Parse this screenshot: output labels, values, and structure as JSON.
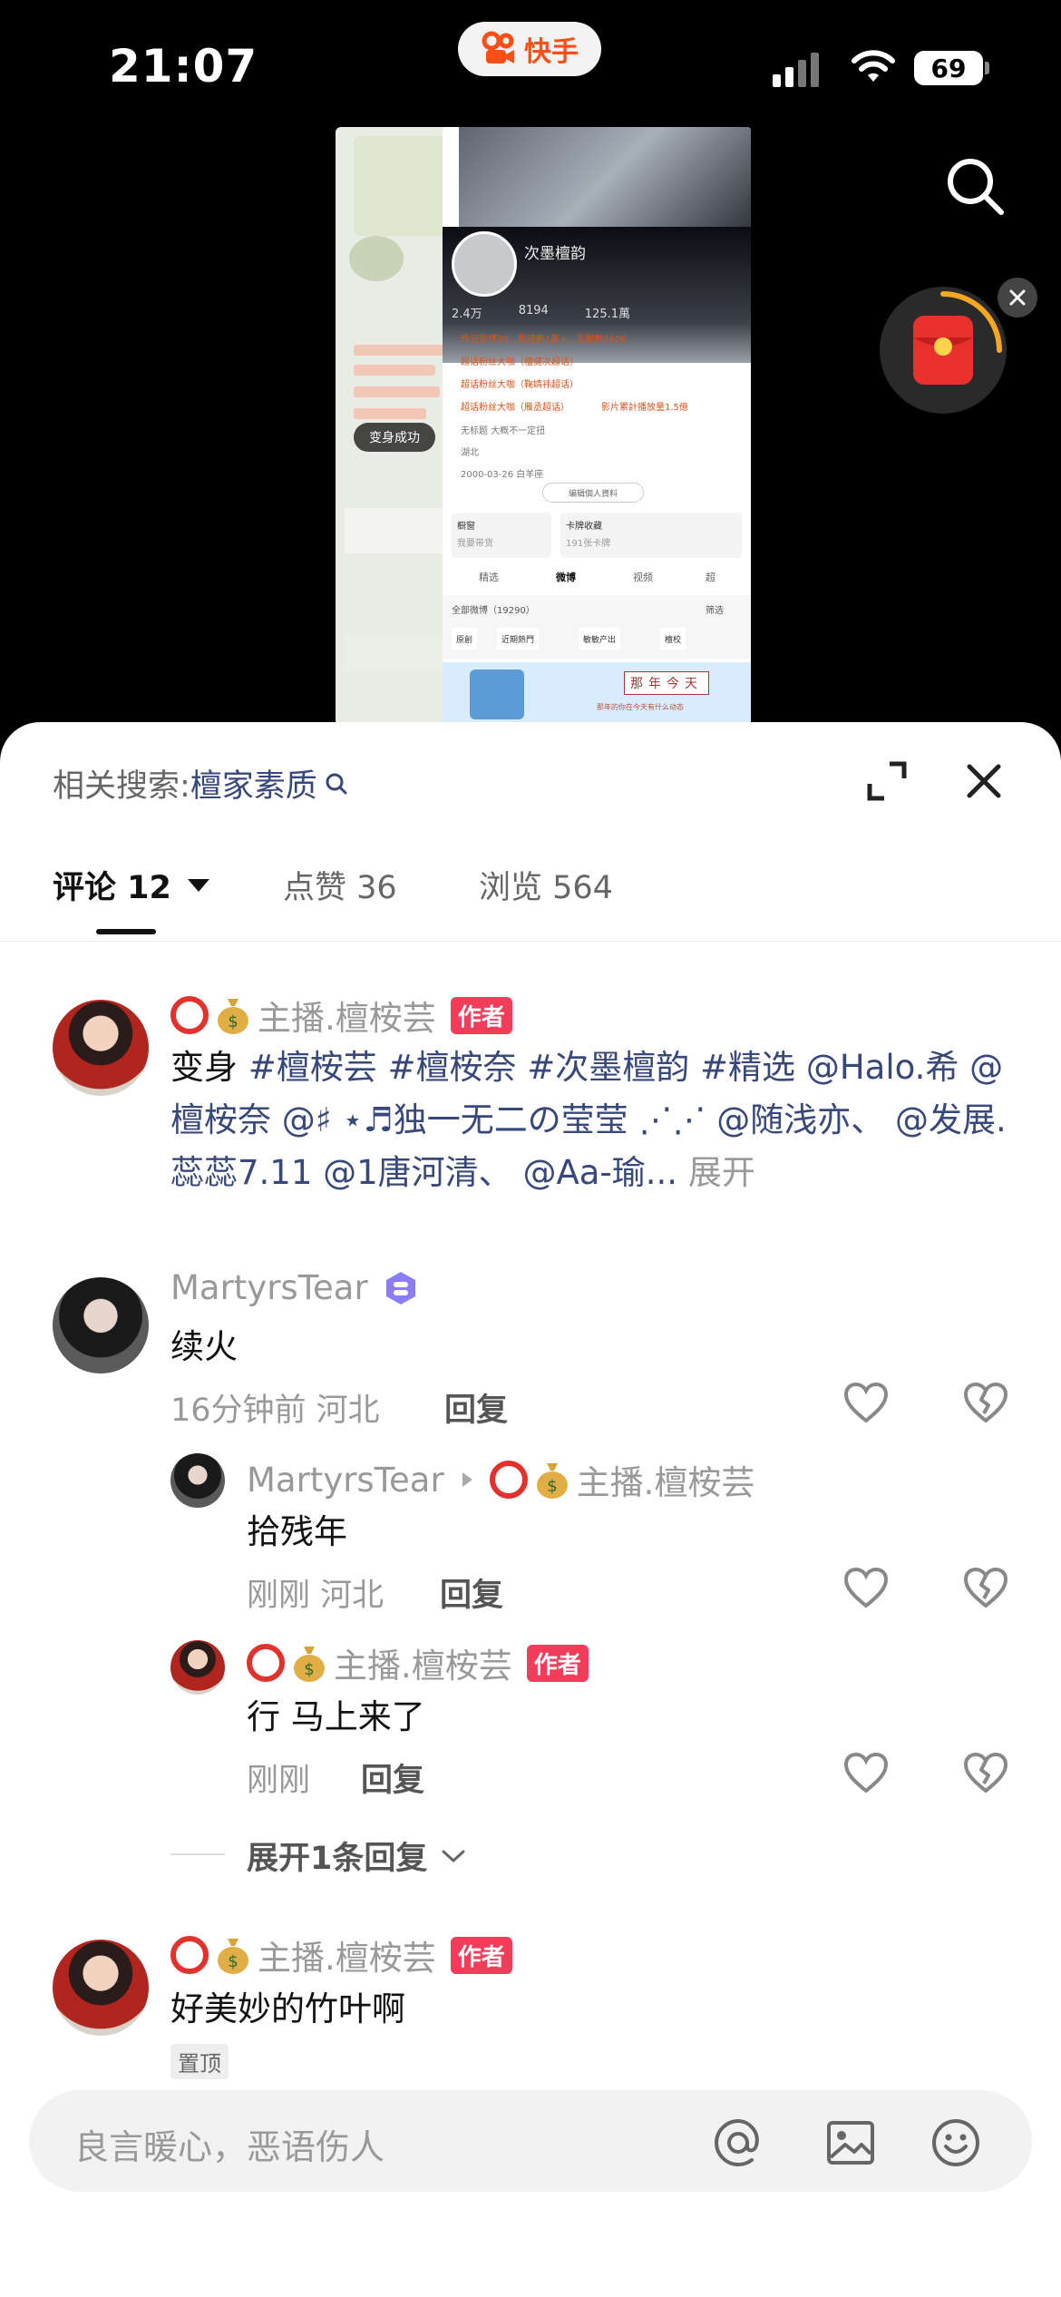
{
  "status_bar": {
    "time": "21:07",
    "app_name": "快手",
    "battery": "69"
  },
  "colors": {
    "accent_red": "#f13c5a",
    "link_blue": "#38487a",
    "brand_orange": "#ff4e17"
  },
  "preview": {
    "name": "次墨檀韵",
    "stats": [
      "2.4万",
      "8194",
      "125.1萬"
    ],
    "line1": "昨日發博39，閱讀數1萬+，互動數1606",
    "line2": "超话粉丝大咖（檀健次超话）",
    "line3": "超话粉丝大咖（鞠婧祎超话）",
    "line4": "超话粉丝大咖（雁丞超话）",
    "line4b": "影片累計播放量1.5億",
    "line5": "无标题 大概不一定扭",
    "line6": "湖北",
    "line7": "2000-03-26 白羊座",
    "edit_btn": "编辑個人資料",
    "card1_title": "橱窗",
    "card1_sub": "我要带货",
    "card2_title": "卡牌收藏",
    "card2_sub": "191张卡牌",
    "tab1": "精选",
    "tab2": "微博",
    "tab3": "视频",
    "tab4": "超",
    "filter": "筛选",
    "all_weibo": "全部微博（19290）",
    "chip1": "原創",
    "chip2": "近期熱門",
    "chip3": "敏敏产出",
    "chip4": "檀校",
    "ad_text": "那年今天",
    "ad_sub": "那年的你在今天有什么动态",
    "toast": "变身成功"
  },
  "sheet": {
    "related_label": "相关搜索:",
    "related_keyword": "檀家素质",
    "tabs": [
      {
        "label": "评论 12"
      },
      {
        "label": "点赞 36"
      },
      {
        "label": "浏览 564"
      }
    ]
  },
  "comments": {
    "c1": {
      "name": "主播.檀桉芸",
      "author_tag": "作者",
      "body_start": "变身 ",
      "body_tags": "#檀桉芸 #檀桉奈 #次墨檀韵 #精选 @Halo.希 @檀桉奈 @♯ ⋆♬独一无二の莹莹 ⋰⋰ @随浅亦、 @发展. 蕊蕊7.11 @1唐河清、 @Aa-瑜...",
      "more": " 展开"
    },
    "c2": {
      "name": "MartyrsTear",
      "body": "续火",
      "meta": "16分钟前 河北",
      "reply": "回复"
    },
    "r1": {
      "name": "MartyrsTear",
      "to_name": "主播.檀桉芸",
      "body": "拾残年",
      "meta": "刚刚 河北",
      "reply": "回复"
    },
    "r2": {
      "name": "主播.檀桉芸",
      "author_tag": "作者",
      "body": "行 马上来了",
      "meta": "刚刚",
      "reply": "回复"
    },
    "expand": "展开1条回复",
    "c3": {
      "name": "主播.檀桉芸",
      "author_tag": "作者",
      "body": "好美妙的竹叶啊",
      "pin": "置顶"
    }
  },
  "input": {
    "placeholder": "良言暖心，恶语伤人"
  }
}
